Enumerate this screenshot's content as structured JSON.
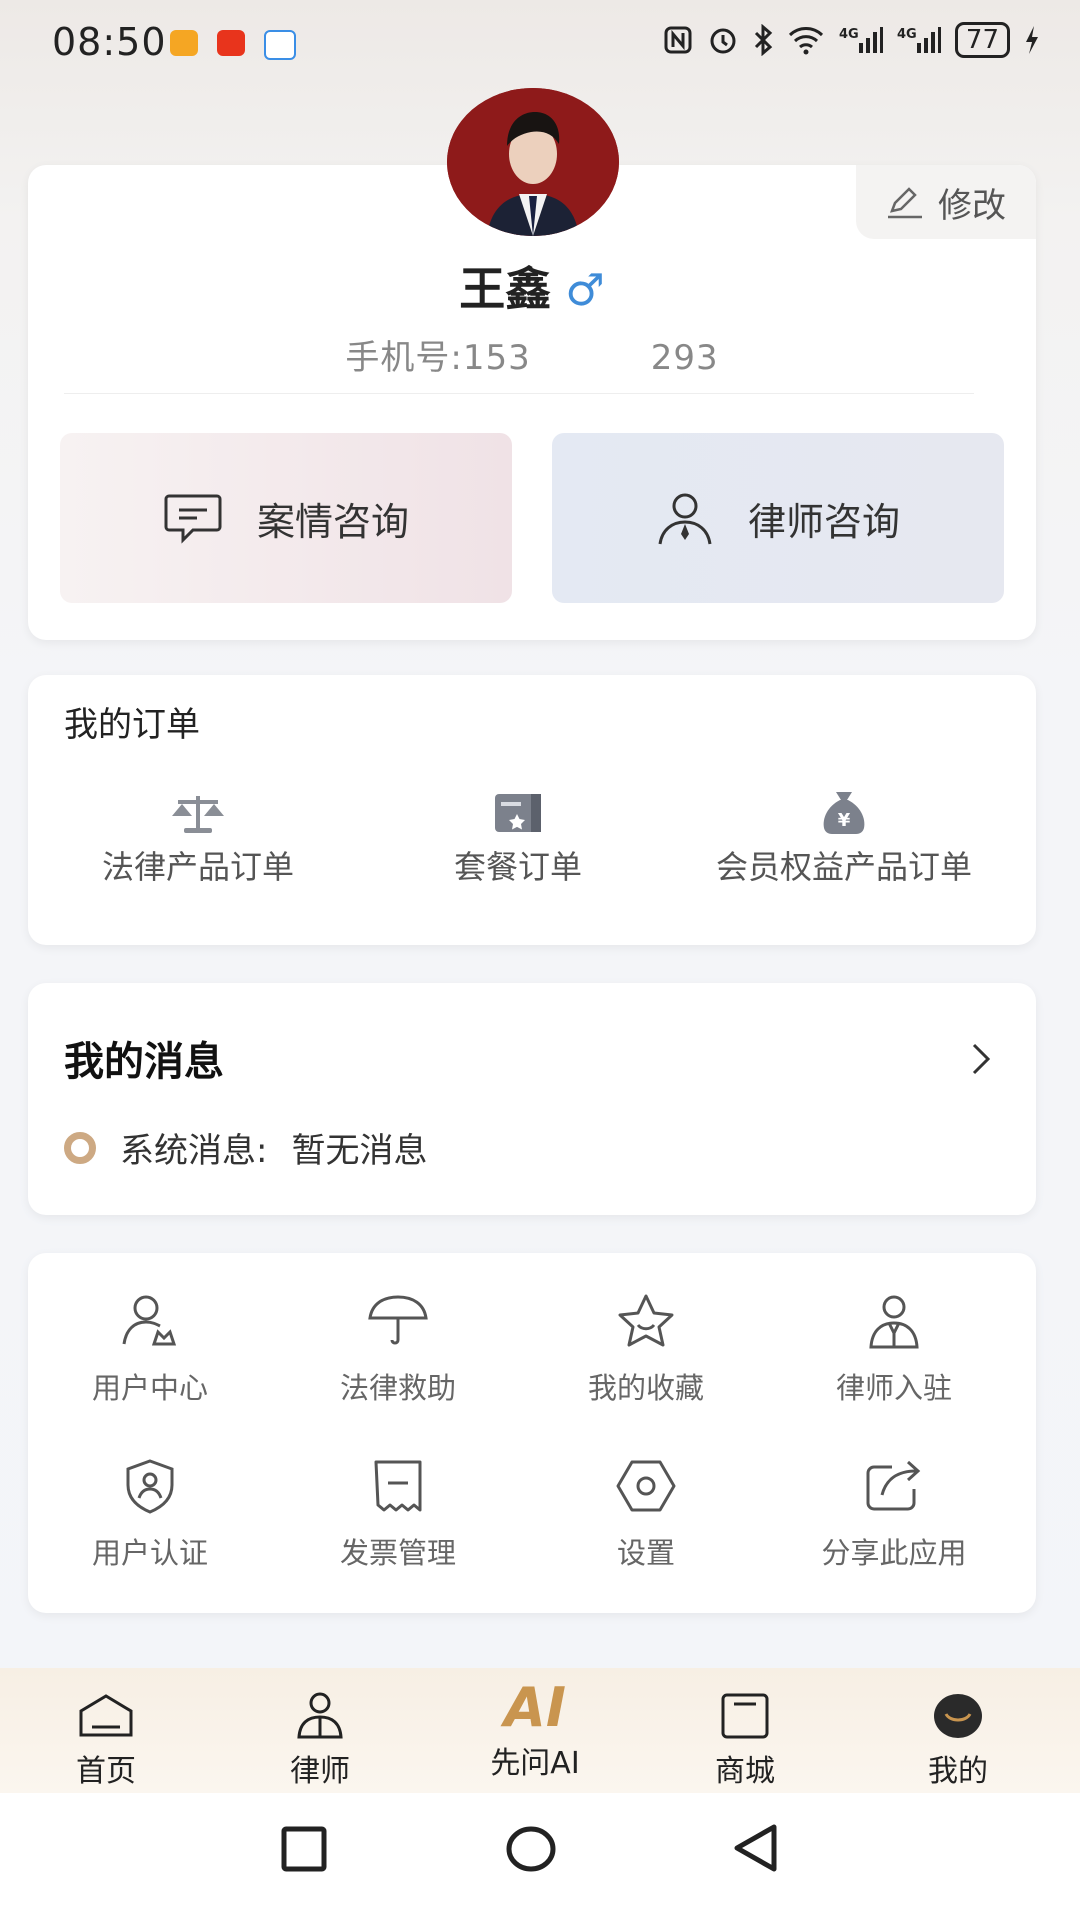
{
  "status_bar": {
    "time": "08:50",
    "battery": "77"
  },
  "profile": {
    "edit_label": "修改",
    "name": "王鑫",
    "gender_symbol": "♂",
    "phone_prefix": "手机号:153",
    "phone_suffix": "293",
    "consult_case_label": "案情咨询",
    "consult_lawyer_label": "律师咨询"
  },
  "orders": {
    "title": "我的订单",
    "items": [
      {
        "label": "法律产品订单",
        "icon": "scale-icon"
      },
      {
        "label": "套餐订单",
        "icon": "package-card-icon"
      },
      {
        "label": "会员权益产品订单",
        "icon": "money-bag-icon"
      }
    ]
  },
  "messages": {
    "title": "我的消息",
    "system_label": "系统消息:",
    "system_value": "暂无消息"
  },
  "tools": [
    {
      "label": "用户中心",
      "icon": "user-center-icon"
    },
    {
      "label": "法律救助",
      "icon": "umbrella-icon"
    },
    {
      "label": "我的收藏",
      "icon": "star-icon"
    },
    {
      "label": "律师入驻",
      "icon": "lawyer-icon"
    },
    {
      "label": "用户认证",
      "icon": "shield-user-icon"
    },
    {
      "label": "发票管理",
      "icon": "invoice-icon"
    },
    {
      "label": "设置",
      "icon": "settings-icon"
    },
    {
      "label": "分享此应用",
      "icon": "share-icon"
    }
  ],
  "tabbar": {
    "items": [
      {
        "label": "首页",
        "icon": "home-icon"
      },
      {
        "label": "律师",
        "icon": "lawyer-tab-icon"
      },
      {
        "label": "先问AI",
        "icon": "ai-icon",
        "icon_text": "AI"
      },
      {
        "label": "商城",
        "icon": "shop-icon"
      },
      {
        "label": "我的",
        "icon": "me-icon"
      }
    ]
  },
  "colors": {
    "accent": "#c9954f",
    "male": "#3f8cd8",
    "message_dot": "#cda983"
  }
}
